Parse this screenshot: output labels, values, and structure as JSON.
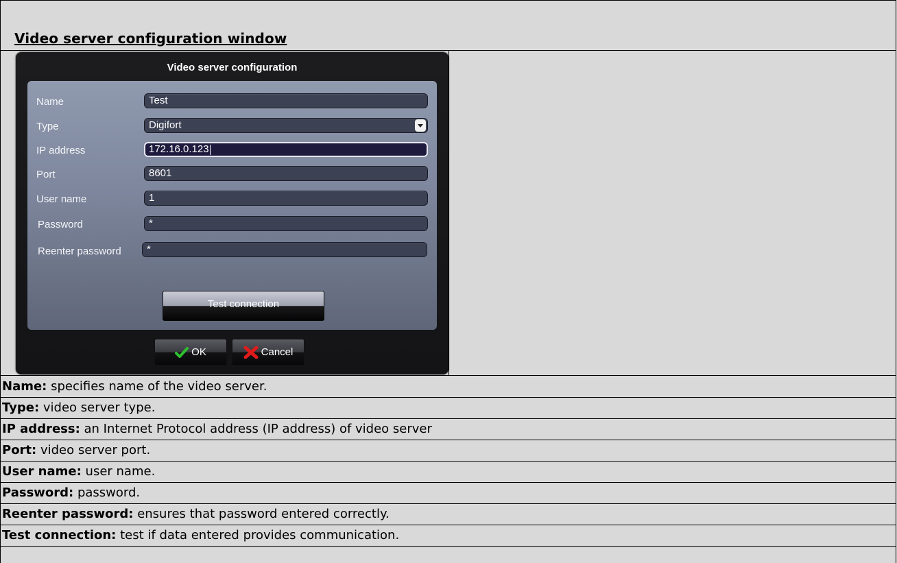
{
  "doc": {
    "title": "Video server configuration window"
  },
  "dialog": {
    "title": "Video server configuration",
    "fields": {
      "name": {
        "label": "Name",
        "value": "Test"
      },
      "type": {
        "label": "Type",
        "value": "Digifort"
      },
      "ip": {
        "label": "IP address",
        "value": "172.16.0.123"
      },
      "port": {
        "label": "Port",
        "value": "8601"
      },
      "user": {
        "label": "User name",
        "value": "1"
      },
      "password": {
        "label": "Password",
        "value": "*"
      },
      "reenter": {
        "label": "Reenter password",
        "value": "*"
      }
    },
    "test_button": "Test connection",
    "ok_button": "OK",
    "cancel_button": "Cancel"
  },
  "descriptions": [
    {
      "term": "Name:",
      "text": " specifies name of the video server."
    },
    {
      "term": "Type:",
      "text": " video server type."
    },
    {
      "term": "IP address:",
      "text": " an Internet Protocol address (IP address) of video server"
    },
    {
      "term": "Port:",
      "text": " video server port."
    },
    {
      "term": "User name:",
      "text": " user name."
    },
    {
      "term": "Password:",
      "text": " password."
    },
    {
      "term": "Reenter password:",
      "text": " ensures that password entered correctly."
    },
    {
      "term": "Test connection:",
      "text": " test if data entered provides communication."
    }
  ],
  "colors": {
    "page_bg": "#d9d9d9",
    "dialog_bg": "#1c1c1e",
    "panel_top": "#909aaf",
    "field_bg": "#3c4154",
    "ok_check": "#2fbf2f",
    "cancel_x": "#e01b1b"
  }
}
